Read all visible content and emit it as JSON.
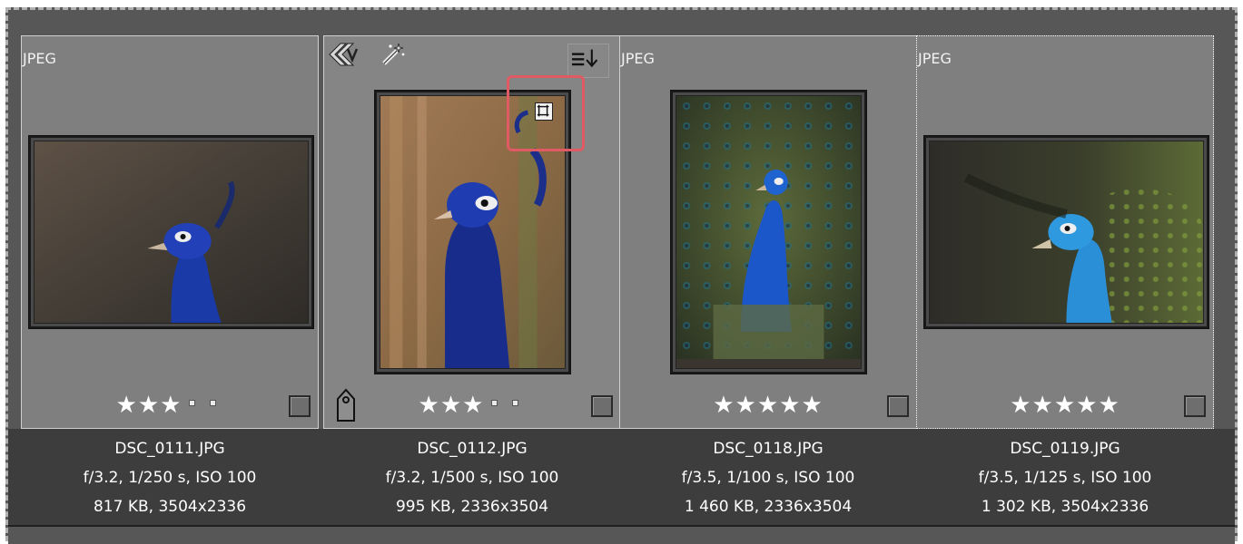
{
  "thumbnails": [
    {
      "format": "JPEG",
      "filename": "DSC_0111.JPG",
      "exposure": "f/3.2, 1/250 s, ISO 100",
      "size_dims": "817 KB, 3504x2336",
      "rating": 3,
      "rating_max": 5
    },
    {
      "filename": "DSC_0112.JPG",
      "exposure": "f/3.2, 1/500 s, ISO 100",
      "size_dims": "995 KB, 2336x3504",
      "rating": 3,
      "rating_max": 5
    },
    {
      "format": "JPEG",
      "filename": "DSC_0118.JPG",
      "exposure": "f/3.5, 1/100 s, ISO 100",
      "size_dims": "1 460 KB, 2336x3504",
      "rating": 5,
      "rating_max": 5
    },
    {
      "format": "JPEG",
      "filename": "DSC_0119.JPG",
      "exposure": "f/3.5, 1/125 s, ISO 100",
      "size_dims": "1 302 KB, 3504x2336",
      "rating": 5,
      "rating_max": 5
    }
  ],
  "colors": {
    "cell_bg": "#7f7f7f",
    "label_strip_bg": "#3d3d3d",
    "highlight_box": "#e05a63"
  },
  "icons": {
    "versions": "versions-stack-icon",
    "edited": "magic-wand-icon",
    "sidecar": "lines-arrow-down-icon",
    "crop": "crop-icon",
    "tag": "tag-icon"
  }
}
